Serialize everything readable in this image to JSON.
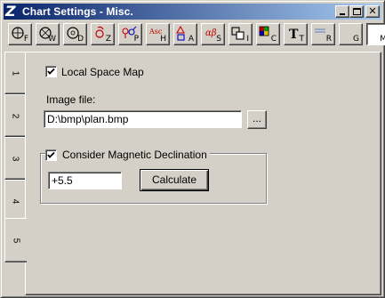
{
  "window": {
    "title": "Chart Settings - Misc.",
    "app_logo": "Z"
  },
  "toolbar": {
    "buttons": [
      {
        "letter": "F",
        "icon": "circle-f-icon"
      },
      {
        "letter": "W",
        "icon": "circle-w-icon"
      },
      {
        "letter": "D",
        "icon": "circle-d-icon"
      },
      {
        "letter": "Z",
        "icon": "planet-z-icon"
      },
      {
        "letter": "P",
        "icon": "planet-pair-p-icon"
      },
      {
        "letter": "H",
        "icon": "asc-h-icon",
        "top_text": "Asc"
      },
      {
        "letter": "A",
        "icon": "triangle-square-a-icon"
      },
      {
        "letter": "S",
        "icon": "alpha-beta-s-icon",
        "top_text": "αβ"
      },
      {
        "letter": "I",
        "icon": "squares-i-icon"
      },
      {
        "letter": "C",
        "icon": "color-grid-c-icon"
      },
      {
        "letter": "T",
        "icon": "font-t-icon"
      },
      {
        "letter": "R",
        "icon": "lines-r-icon"
      },
      {
        "letter": "G",
        "icon": "blank-g-icon"
      },
      {
        "letter": "M",
        "icon": "blank-m-icon"
      }
    ]
  },
  "tabs": [
    "1",
    "2",
    "3",
    "4",
    "5"
  ],
  "active_tab": "5",
  "form": {
    "local_space_map": {
      "label": "Local Space Map",
      "checked": true
    },
    "image_file": {
      "label": "Image file:",
      "value": "D:\\bmp\\plan.bmp",
      "browse_label": "..."
    },
    "magnetic": {
      "label": "Consider Magnetic Declination",
      "checked": true,
      "value": "+5.5",
      "calculate_label": "Calculate"
    }
  },
  "colors": {
    "titlebar_start": "#0a246a",
    "titlebar_end": "#a6caf0",
    "face": "#d4d0c8"
  }
}
